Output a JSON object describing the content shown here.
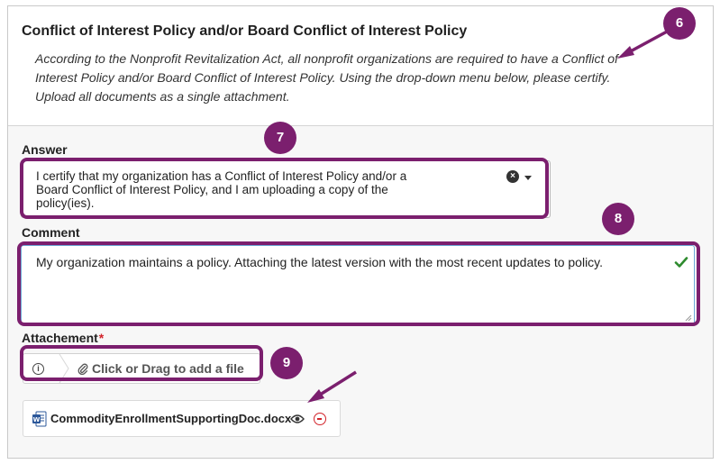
{
  "question": {
    "title": "Conflict of Interest Policy and/or Board Conflict of Interest Policy",
    "description": "According to the Nonprofit Revitalization Act, all nonprofit organizations are required to have a Conflict of Interest Policy and/or Board Conflict of Interest Policy. Using the drop-down menu below, please certify. Upload all documents as a single attachment."
  },
  "answer": {
    "label": "Answer",
    "selected_value": "I certify that my organization has a Conflict of Interest Policy and/or a Board Conflict of Interest Policy, and I am uploading a copy of the policy(ies).",
    "clear_icon": "clear-circle-icon",
    "dropdown_icon": "caret-down-icon"
  },
  "comment": {
    "label": "Comment",
    "value": "My organization maintains a policy. Attaching the latest version with the most recent updates to policy.",
    "valid_icon": "checkmark-icon"
  },
  "attachment": {
    "label": "Attachement",
    "required_marker": "*",
    "dropzone_text": "Click or Drag to add a file",
    "info_icon": "info-circle-icon"
  },
  "file": {
    "name": "CommodityEnrollmentSupportingDoc.docx",
    "type_icon": "word-doc-icon"
  },
  "annotations": {
    "badge_6": "6",
    "badge_7": "7",
    "badge_8": "8",
    "badge_9": "9",
    "color": "#7b1f6e"
  },
  "colors": {
    "required": "#d2232a",
    "valid": "#2e8b2e",
    "focus_border": "#6aa9d6"
  }
}
